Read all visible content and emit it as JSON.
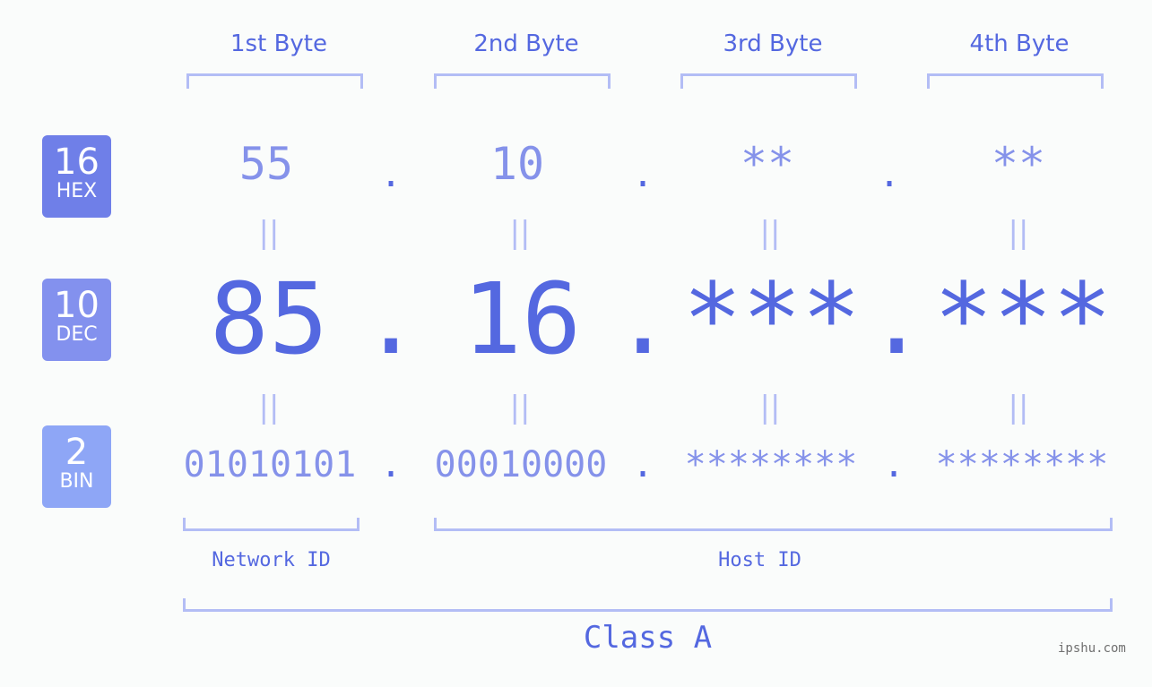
{
  "bytes": [
    {
      "label": "1st Byte",
      "hex": "55",
      "dec": "85",
      "bin": "01010101"
    },
    {
      "label": "2nd Byte",
      "hex": "10",
      "dec": "16",
      "bin": "00010000"
    },
    {
      "label": "3rd Byte",
      "hex": "**",
      "dec": "***",
      "bin": "********"
    },
    {
      "label": "4th Byte",
      "hex": "**",
      "dec": "***",
      "bin": "********"
    }
  ],
  "badges": {
    "hex": {
      "num": "16",
      "label": "HEX",
      "color": "#6f7fe8"
    },
    "dec": {
      "num": "10",
      "label": "DEC",
      "color": "#8391ee"
    },
    "bin": {
      "num": "2",
      "label": "BIN",
      "color": "#8ea6f6"
    }
  },
  "separator": ".",
  "equals": "||",
  "network_id_label": "Network ID",
  "host_id_label": "Host ID",
  "class_label": "Class A",
  "watermark": "ipshu.com"
}
